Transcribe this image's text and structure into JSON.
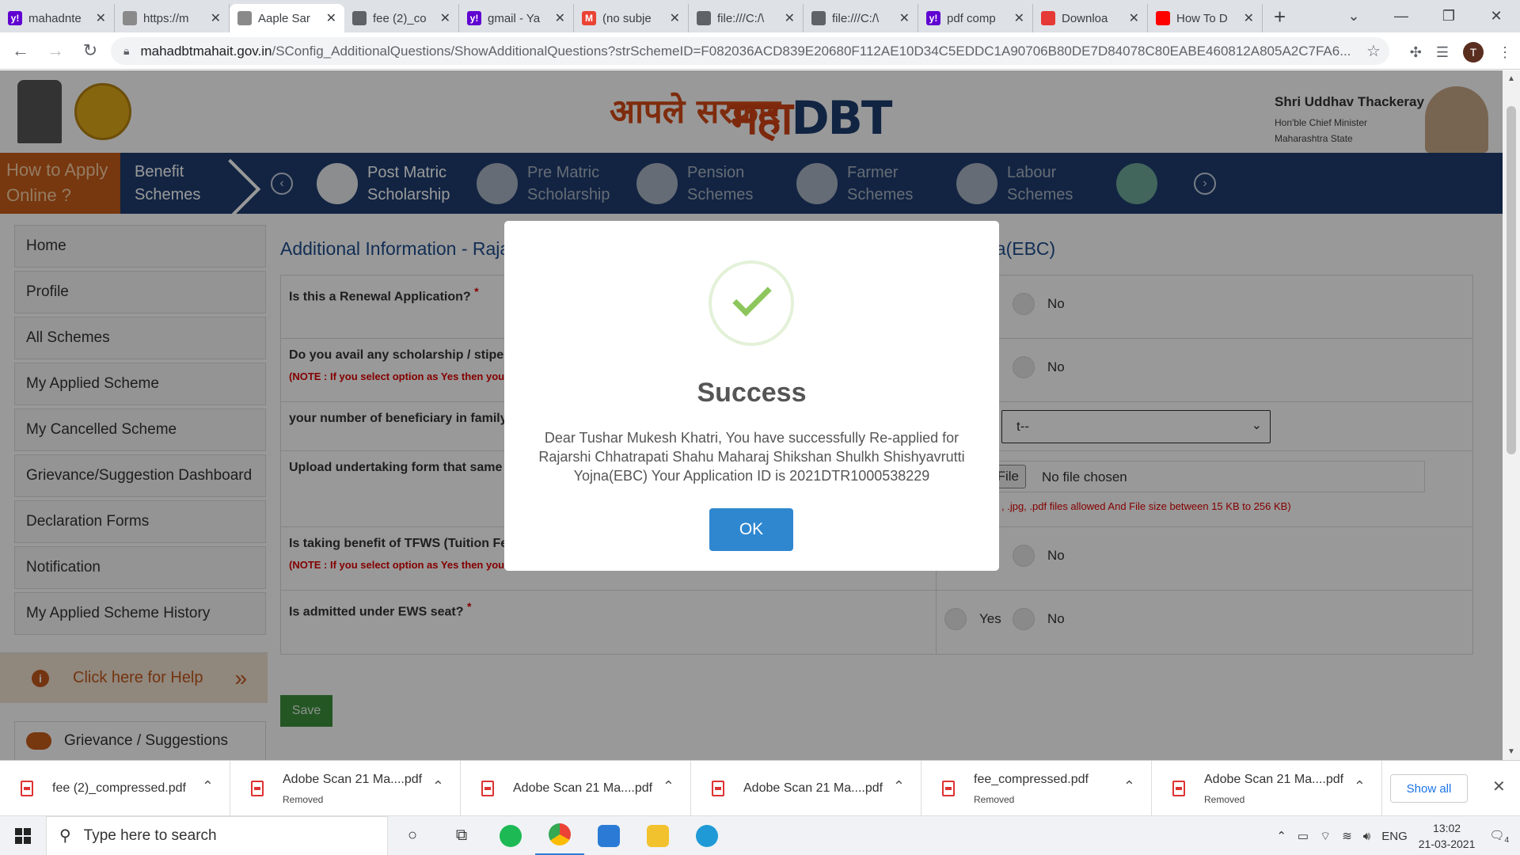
{
  "browser": {
    "tabs": [
      {
        "title": "mahadnte",
        "favicon_color": "#5f01d1",
        "favicon_glyph": "y!"
      },
      {
        "title": "https://m",
        "favicon_color": "#8a8a8a",
        "favicon_glyph": ""
      },
      {
        "title": "Aaple Sar",
        "favicon_color": "#8a8a8a",
        "favicon_glyph": "",
        "active": true
      },
      {
        "title": "fee (2)_co",
        "favicon_color": "#5f6368",
        "favicon_glyph": ""
      },
      {
        "title": "gmail - Ya",
        "favicon_color": "#5f01d1",
        "favicon_glyph": "y!"
      },
      {
        "title": "(no subje",
        "favicon_color": "#ea4335",
        "favicon_glyph": "M"
      },
      {
        "title": "file:///C:/\\",
        "favicon_color": "#5f6368",
        "favicon_glyph": ""
      },
      {
        "title": "file:///C:/\\",
        "favicon_color": "#5f6368",
        "favicon_glyph": ""
      },
      {
        "title": "pdf comp",
        "favicon_color": "#5f01d1",
        "favicon_glyph": "y!"
      },
      {
        "title": "Downloa",
        "favicon_color": "#e53935",
        "favicon_glyph": ""
      },
      {
        "title": "How To D",
        "favicon_color": "#ff0000",
        "favicon_glyph": ""
      }
    ],
    "url_host": "mahadbtmahait.gov.in",
    "url_path": "/SConfig_AdditionalQuestions/ShowAdditionalQuestions?strSchemeID=F082036ACD839E20680F112AE10D34C5EDDC1A90706B80DE7D84078C80EABE460812A805A2C7FA6...",
    "avatar_letter": "T"
  },
  "header": {
    "logo_left": "आपले सरकार",
    "logo_right_a": "महा",
    "logo_right_b": "DBT",
    "minister_name": "Shri Uddhav Thackeray",
    "minister_title": "Hon'ble Chief Minister",
    "minister_state": "Maharashtra State"
  },
  "nav": {
    "how_to": "How to Apply Online ?",
    "benefit": "Benefit Schemes",
    "items": [
      {
        "label": "Post Matric Scholarship",
        "active": true
      },
      {
        "label": "Pre Matric Scholarship"
      },
      {
        "label": "Pension Schemes"
      },
      {
        "label": "Farmer Schemes"
      },
      {
        "label": "Labour Schemes"
      }
    ]
  },
  "sidebar": {
    "items": [
      {
        "label": "Home"
      },
      {
        "label": "Profile"
      },
      {
        "label": "All Schemes"
      },
      {
        "label": "My Applied Scheme"
      },
      {
        "label": "My Cancelled Scheme"
      },
      {
        "label": "Grievance/Suggestion Dashboard"
      },
      {
        "label": "Declaration Forms"
      },
      {
        "label": "Notification"
      },
      {
        "label": "My Applied Scheme History"
      }
    ],
    "help": "Click here for Help",
    "grievance": "Grievance / Suggestions"
  },
  "main": {
    "title_left": "Additional Information - Raja",
    "title_right": "na(EBC)",
    "questions": [
      {
        "label": "Is this a Renewal Application?",
        "required": true,
        "note": "",
        "no": "No"
      },
      {
        "label": "Do you avail any scholarship / stipend",
        "required": false,
        "note": "(NOTE : If you select option as Yes then you w",
        "no": "No"
      },
      {
        "label": "your number of beneficiary in family ?",
        "required": false,
        "note": "",
        "select_value": "t--"
      },
      {
        "label": "Upload undertaking form that same y",
        "required": false,
        "note": "",
        "file_button": "se File",
        "file_text": "No file chosen",
        "file_note": ", .jpg, .pdf files allowed And File size between 15 KB to 256 KB)"
      },
      {
        "label": "Is taking benefit of TFWS (Tuition Fee",
        "required": false,
        "note": "(NOTE : If you select option as Yes then you w",
        "no": "No"
      },
      {
        "label": "Is admitted under EWS seat?",
        "required": true,
        "note": "",
        "yes": "Yes",
        "no": "No"
      }
    ],
    "save": "Save"
  },
  "modal": {
    "title": "Success",
    "message": "Dear Tushar Mukesh Khatri, You have successfully Re-applied for Rajarshi Chhatrapati Shahu Maharaj Shikshan Shulkh Shishyavrutti Yojna(EBC) Your Application ID is 2021DTR1000538229",
    "ok": "OK"
  },
  "downloads": {
    "items": [
      {
        "name": "fee (2)_compressed.pdf",
        "status": ""
      },
      {
        "name": "Adobe Scan 21 Ma....pdf",
        "status": "Removed"
      },
      {
        "name": "Adobe Scan 21 Ma....pdf",
        "status": ""
      },
      {
        "name": "Adobe Scan 21 Ma....pdf",
        "status": ""
      },
      {
        "name": "fee_compressed.pdf",
        "status": "Removed"
      },
      {
        "name": "Adobe Scan 21 Ma....pdf",
        "status": "Removed"
      }
    ],
    "show_all": "Show all"
  },
  "taskbar": {
    "search_placeholder": "Type here to search",
    "lang": "ENG",
    "time": "13:02",
    "date": "21-03-2021",
    "notif_count": "4"
  }
}
